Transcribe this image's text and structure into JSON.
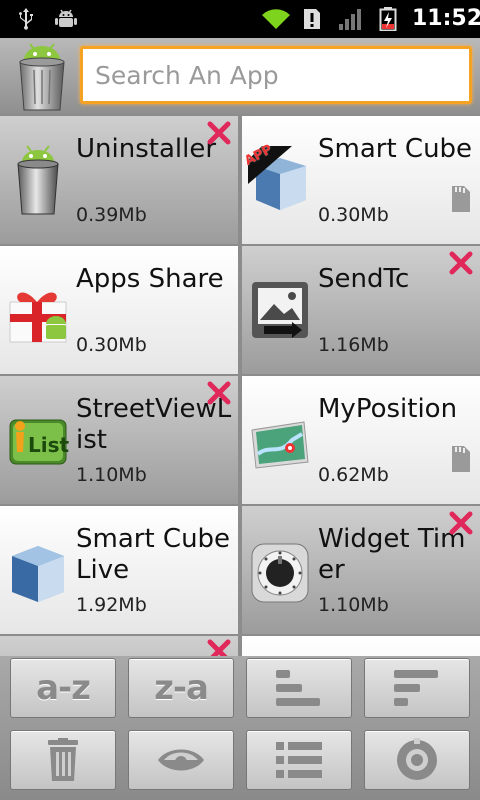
{
  "status_bar": {
    "time": "11:52",
    "icons": [
      "usb-icon",
      "android-debug-icon",
      "wifi-icon",
      "alert-icon",
      "signal-icon",
      "battery-charging-icon"
    ]
  },
  "header": {
    "logo_icon": "trash-android-icon",
    "search": {
      "value": "",
      "placeholder": "Search An App"
    }
  },
  "apps": [
    {
      "name": "Uninstaller",
      "size": "0.39Mb",
      "icon": "uninstaller-trash-icon",
      "theme": "gray",
      "action": "close-icon"
    },
    {
      "name": "Smart Cube",
      "size": "0.30Mb",
      "icon": "smart-cube-icon",
      "theme": "white",
      "action": "sd-card-icon",
      "badge": "APP"
    },
    {
      "name": "Apps Share",
      "size": "0.30Mb",
      "icon": "gift-icon",
      "theme": "white",
      "action": ""
    },
    {
      "name": "SendTc",
      "size": "1.16Mb",
      "icon": "sendtc-photo-icon",
      "theme": "gray",
      "action": "close-icon"
    },
    {
      "name": "StreetViewList",
      "size": "1.10Mb",
      "icon": "streetview-list-icon",
      "theme": "gray",
      "action": "close-icon"
    },
    {
      "name": "MyPosition",
      "size": "0.62Mb",
      "icon": "map-icon",
      "theme": "white",
      "action": "sd-card-icon"
    },
    {
      "name": "Smart Cube Live",
      "size": "1.92Mb",
      "icon": "smart-cube-icon",
      "theme": "white",
      "action": ""
    },
    {
      "name": "Widget Timer",
      "size": "1.10Mb",
      "icon": "timer-dial-icon",
      "theme": "gray",
      "action": "close-icon"
    }
  ],
  "toolbar": {
    "sort_az": "a-z",
    "sort_za": "z-a",
    "icons": [
      "sort-size-ascending-icon",
      "sort-size-descending-icon",
      "trash-icon",
      "eye-icon",
      "list-icon",
      "settings-icon"
    ]
  },
  "colors": {
    "accent": "#f6a323",
    "close": "#e0285a",
    "toolbar_glyph": "#8a8a8a"
  }
}
